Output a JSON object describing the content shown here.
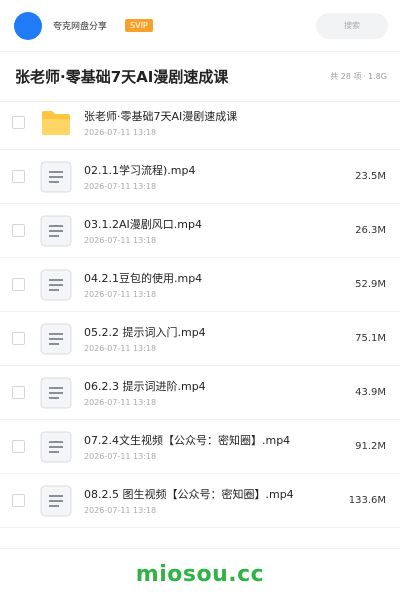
{
  "header": {
    "app_name": "夸克网盘分享",
    "badge": "SVIP",
    "search_placeholder": "搜索"
  },
  "folder": {
    "title": "张老师·零基础7天AI漫剧速成课",
    "count": "共 28 项",
    "separator": "·",
    "size": "1.8G"
  },
  "files": [
    {
      "name": "张老师·零基础7天AI漫剧速成课",
      "date": "2026-07-11 13:18",
      "size": "",
      "icon": "folder-icon"
    },
    {
      "name": "02.1.1学习流程).mp4",
      "date": "2026-07-11 13:18",
      "size": "23.5M",
      "icon": "video-file-icon"
    },
    {
      "name": "03.1.2AI漫剧风口.mp4",
      "date": "2026-07-11 13:18",
      "size": "26.3M",
      "icon": "video-file-icon"
    },
    {
      "name": "04.2.1豆包的使用.mp4",
      "date": "2026-07-11 13:18",
      "size": "52.9M",
      "icon": "video-file-icon"
    },
    {
      "name": "05.2.2 提示词入门.mp4",
      "date": "2026-07-11 13:18",
      "size": "75.1M",
      "icon": "video-file-icon"
    },
    {
      "name": "06.2.3 提示词进阶.mp4",
      "date": "2026-07-11 13:18",
      "size": "43.9M",
      "icon": "video-file-icon"
    },
    {
      "name": "07.2.4文生视频【公众号：密知圈】.mp4",
      "date": "2026-07-11 13:18",
      "size": "91.2M",
      "icon": "video-file-icon"
    },
    {
      "name": "08.2.5 图生视频【公众号：密知圈】.mp4",
      "date": "2026-07-11 13:18",
      "size": "133.6M",
      "icon": "video-file-icon"
    }
  ],
  "watermark": "miosou.cc",
  "colors": {
    "avatar": "#1f7cf6",
    "badge": "#f7a12b",
    "folder": "#ffc53d",
    "watermark": "#2fb344"
  }
}
